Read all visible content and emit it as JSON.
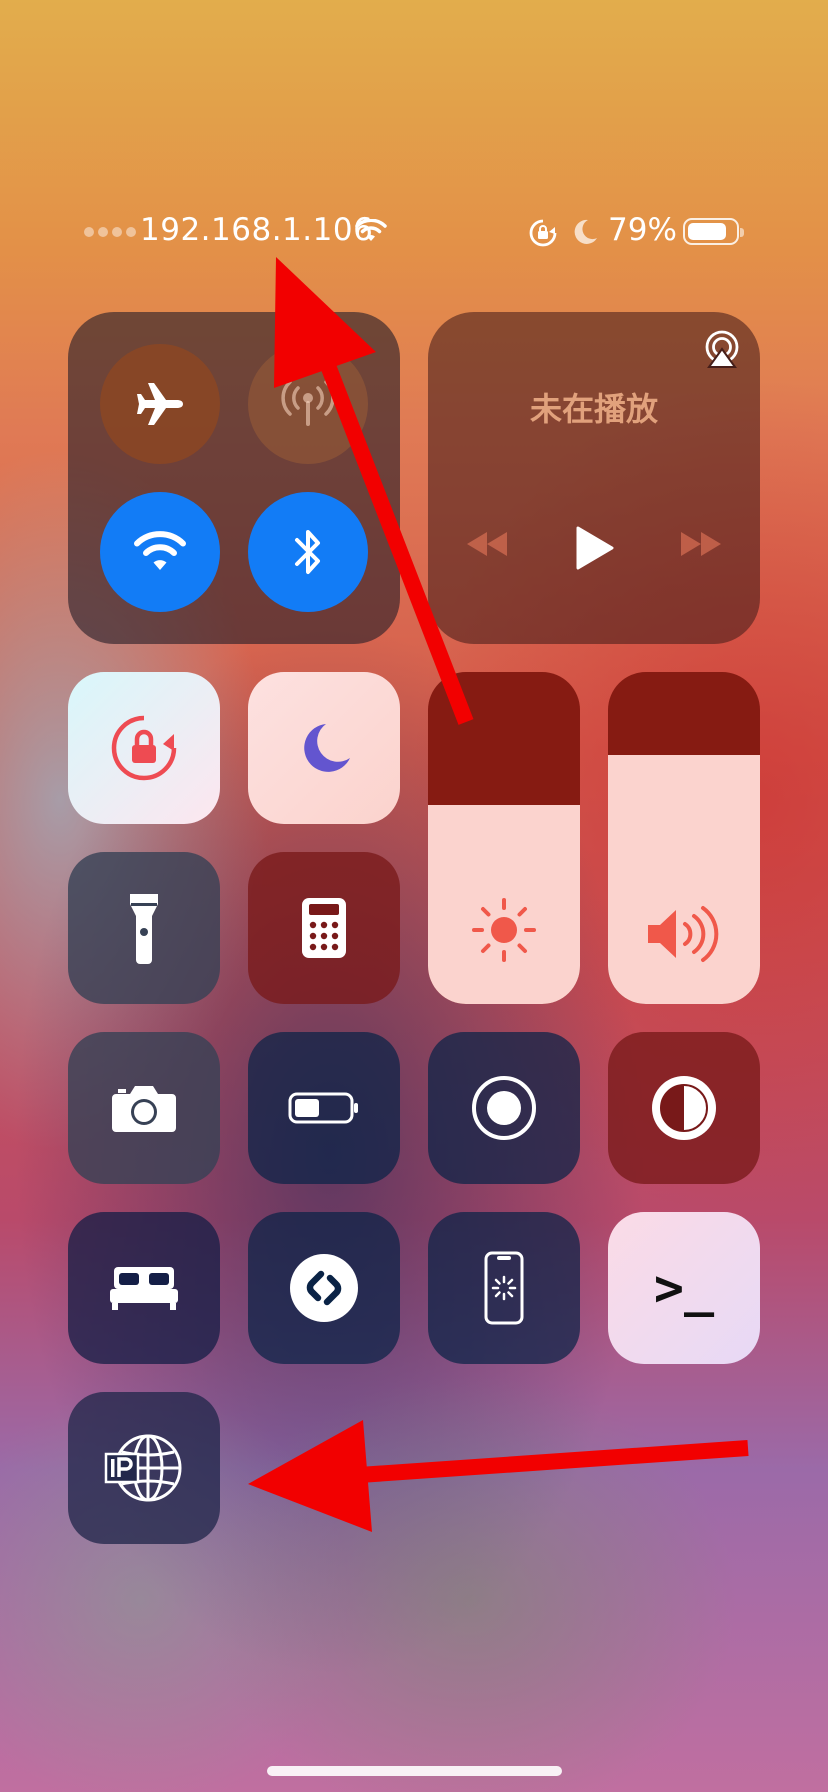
{
  "status_bar": {
    "ip_address": "192.168.1.106",
    "battery_percent_text": "79%",
    "battery_level": 0.79,
    "icons": [
      "signal-dots-icon",
      "wifi-icon",
      "orientation-lock-icon",
      "moon-icon",
      "battery-icon"
    ]
  },
  "connectivity": {
    "airplane_mode": {
      "icon": "airplane-icon",
      "on": true
    },
    "cellular_data": {
      "icon": "cellular-antenna-icon",
      "on": false
    },
    "wifi": {
      "icon": "wifi-icon",
      "on": true
    },
    "bluetooth": {
      "icon": "bluetooth-icon",
      "on": true
    }
  },
  "now_playing": {
    "title": "未在播放",
    "icons": [
      "airplay-audio-icon",
      "previous-track-icon",
      "play-icon",
      "next-track-icon"
    ]
  },
  "controls": {
    "orientation_lock": {
      "icon": "orientation-lock-icon",
      "on": true
    },
    "do_not_disturb": {
      "icon": "moon-icon",
      "on": true
    },
    "flashlight": {
      "icon": "flashlight-icon"
    },
    "calculator": {
      "icon": "calculator-icon"
    },
    "camera": {
      "icon": "camera-icon"
    },
    "low_power_mode": {
      "icon": "battery-icon"
    },
    "screen_recording": {
      "icon": "record-icon"
    },
    "dark_mode": {
      "icon": "contrast-icon"
    },
    "sleep": {
      "icon": "bed-icon"
    },
    "shazam": {
      "icon": "shazam-icon"
    },
    "screen_mirroring_app": {
      "icon": "phone-loading-icon"
    },
    "terminal_shortcut": {
      "label": ">_",
      "icon": "terminal-icon"
    },
    "ip_widget": {
      "icon": "ip-globe-icon"
    }
  },
  "sliders": {
    "brightness": {
      "level": 0.6,
      "icon": "sun-icon"
    },
    "volume": {
      "level": 0.75,
      "icon": "speaker-icon"
    }
  },
  "colors": {
    "accent_blue": "#127cf6",
    "slider_track": "#861b12",
    "slider_fill": "#fbd3ce",
    "media_title": "#e1a17c",
    "annotation_arrow": "#f20000"
  }
}
